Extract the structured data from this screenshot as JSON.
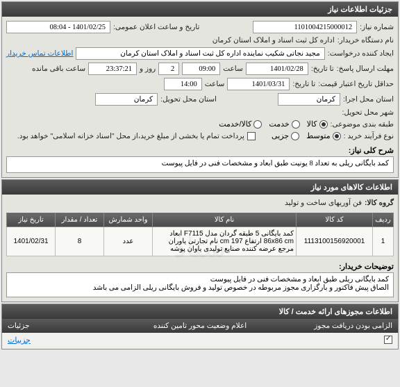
{
  "panels": {
    "main_header": "جزئیات اطلاعات نیاز",
    "items_header": "اطلاعات کالاهای مورد نیاز",
    "permits_header": "اطلاعات مجوزهای ارائه خدمت / کالا"
  },
  "labels": {
    "need_no": "شماره نیاز:",
    "announce_dt": "تاریخ و ساعت اعلان عمومی:",
    "buyer_org": "نام دستگاه خریدار:",
    "requester": "ایجاد کننده درخواست:",
    "buyer_contact": "اطلاعات تماس خریدار",
    "reply_deadline": "مهلت ارسال پاسخ:",
    "date_lbl": "تا تاریخ:",
    "time_lbl": "ساعت",
    "days_lbl": "روز و",
    "remaining": "ساعت باقی مانده",
    "validity_deadline": "حداقل تاریخ اعتبار قیمت:",
    "exec_province": "استان محل اجرا:",
    "delivery_city": "شهر محل تحویل:",
    "delivery_province": "استان محل تحویل:",
    "classification": "طبقه بندی موضوعی:",
    "purchase_type": "نوع فرآیند خرید :",
    "payment_note": "پرداخت تمام یا بخشی از مبلغ خرید،از محل \"اسناد خزانه اسلامی\" خواهد بود.",
    "need_desc": "شرح کلی نیاز:",
    "goods_group": "گروه کالا:",
    "explain": "توضیحات خریدار:",
    "mandatory": "الزامی بودن دریافت مجوز",
    "announce_status": "اعلام وضعیت محور تامین کننده",
    "details": "جزئیات"
  },
  "values": {
    "need_no": "1101004215000012",
    "announce_dt": "1401/02/25 - 08:04",
    "buyer_org": "اداره کل ثبت اسناد و املاک استان کرمان",
    "requester": "مجید نجاتی شکیب نماینده اداره کل ثبت اسناد و املاک استان کرمان",
    "reply_date": "1401/02/28",
    "reply_time": "09:00",
    "days": "2",
    "remaining_time": "23:37:21",
    "validity_date": "1401/03/31",
    "validity_time": "14:00",
    "exec_province": "کرمان",
    "delivery_province": "کرمان",
    "delivery_city": "",
    "need_desc": "کمد بایگانی ریلی به تعداد 8 یونیت طبق ابعاد و مشخصات فنی در فایل پیوست",
    "goods_group": "فن آوریهای ساخت و تولید",
    "explain": "کمد بایگانی ریلی طبق ابعاد و مشخصات فنی در فایل پیوست\nالصاق پیش فاکتور و بارگزاری مجوز مربوطه در خصوص تولید و فروش بایگانی ریلی الزامی می باشد"
  },
  "radios": {
    "classification": [
      {
        "label": "کالا",
        "checked": true
      },
      {
        "label": "خدمت",
        "checked": false
      },
      {
        "label": "کالا/خدمت",
        "checked": false
      }
    ],
    "purchase_type": [
      {
        "label": "متوسط",
        "checked": true
      },
      {
        "label": "جزیی",
        "checked": false
      }
    ]
  },
  "table": {
    "headers": [
      "ردیف",
      "کد کالا",
      "نام کالا",
      "واحد شمارش",
      "تعداد / مقدار",
      "تاریخ نیاز"
    ],
    "rows": [
      {
        "idx": "1",
        "code": "1113100156920001",
        "name": "کمد بایگانی 5 طبقه گردان مدل F7115 ابعاد 86x86 cm ارتفاع 197 cm نام تجارتی یاوران مرجع عرضه کننده صنایع تولیدی یاوان پوشه",
        "unit": "عدد",
        "qty": "8",
        "date": "1401/02/31"
      }
    ]
  },
  "bottom_row": {
    "mandatory_checked": true,
    "details_text": "جزییات"
  }
}
